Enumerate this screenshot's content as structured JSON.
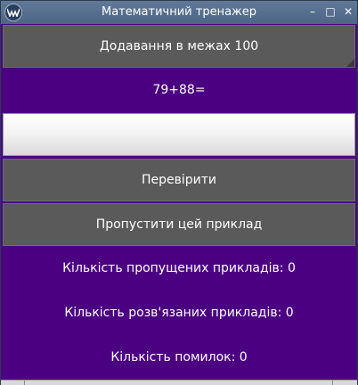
{
  "window": {
    "title": "Математичний тренажер",
    "minimize_glyph": "–",
    "maximize_glyph": "□",
    "close_glyph": "✕"
  },
  "mode_button": {
    "label": "Додавання в межах 100"
  },
  "problem": {
    "expression": "79+88="
  },
  "answer_input": {
    "value": "",
    "placeholder": ""
  },
  "check_button": {
    "label": "Перевірити"
  },
  "skip_button": {
    "label": "Пропустити цей приклад"
  },
  "stats": {
    "skipped": "Кількість пропущених прикладів: 0",
    "solved": "Кількість розв'язаних прикладів: 0",
    "errors": "Кількість помилок: 0"
  },
  "colors": {
    "background": "#4b0082",
    "button": "#5a5a5a",
    "titlebar": "#5a7193",
    "text": "#ffffff"
  },
  "icons": [
    "app-icon",
    "minimize-icon",
    "maximize-icon",
    "close-icon"
  ]
}
